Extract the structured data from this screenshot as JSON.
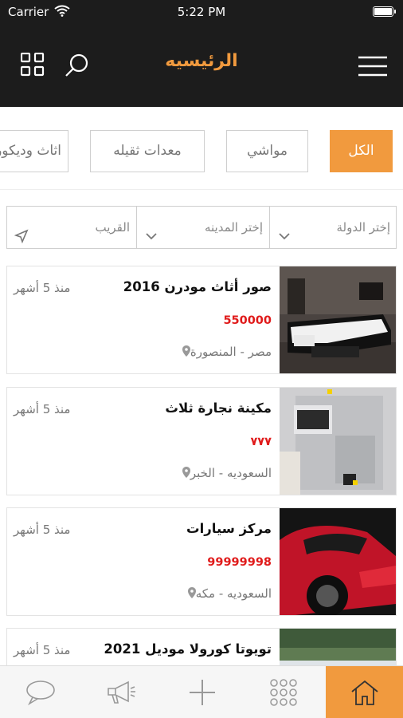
{
  "status_bar": {
    "carrier": "Carrier",
    "time": "5:22 PM"
  },
  "header": {
    "title": "الرئيسيه"
  },
  "categories": [
    {
      "label": "الكل",
      "active": true
    },
    {
      "label": "مواشي",
      "active": false
    },
    {
      "label": "معدات ثقيله",
      "active": false
    },
    {
      "label": "اثاث وديكور",
      "active": false
    }
  ],
  "filters": {
    "country": "إختر الدولة",
    "city": "إختر المدينه",
    "nearby": "القريب"
  },
  "listings": [
    {
      "title": "صور أثاث مودرن 2016",
      "price": "550000",
      "location": "مصر - المنصورة",
      "time": "منذ 5 أشهر"
    },
    {
      "title": "مكينة نجارة ثلاث",
      "price": "٧٧٧",
      "location": "السعوديه - الخبر",
      "time": "منذ 5 أشهر"
    },
    {
      "title": "مركز سيارات",
      "price": "99999998",
      "location": "السعوديه - مكه",
      "time": "منذ 5 أشهر"
    },
    {
      "title": "تويوتا كورولا موديل 2021",
      "price": "",
      "location": "",
      "time": "منذ 5 أشهر"
    }
  ],
  "tab_bar": [
    {
      "icon": "home-icon",
      "active": true
    },
    {
      "icon": "apps-dots-icon",
      "active": false
    },
    {
      "icon": "plus-icon",
      "active": false
    },
    {
      "icon": "megaphone-icon",
      "active": false
    },
    {
      "icon": "chat-bubble-icon",
      "active": false
    }
  ],
  "colors": {
    "accent": "#f19a3e",
    "header_bg": "#1c1c1c",
    "price": "#e01b1b"
  }
}
